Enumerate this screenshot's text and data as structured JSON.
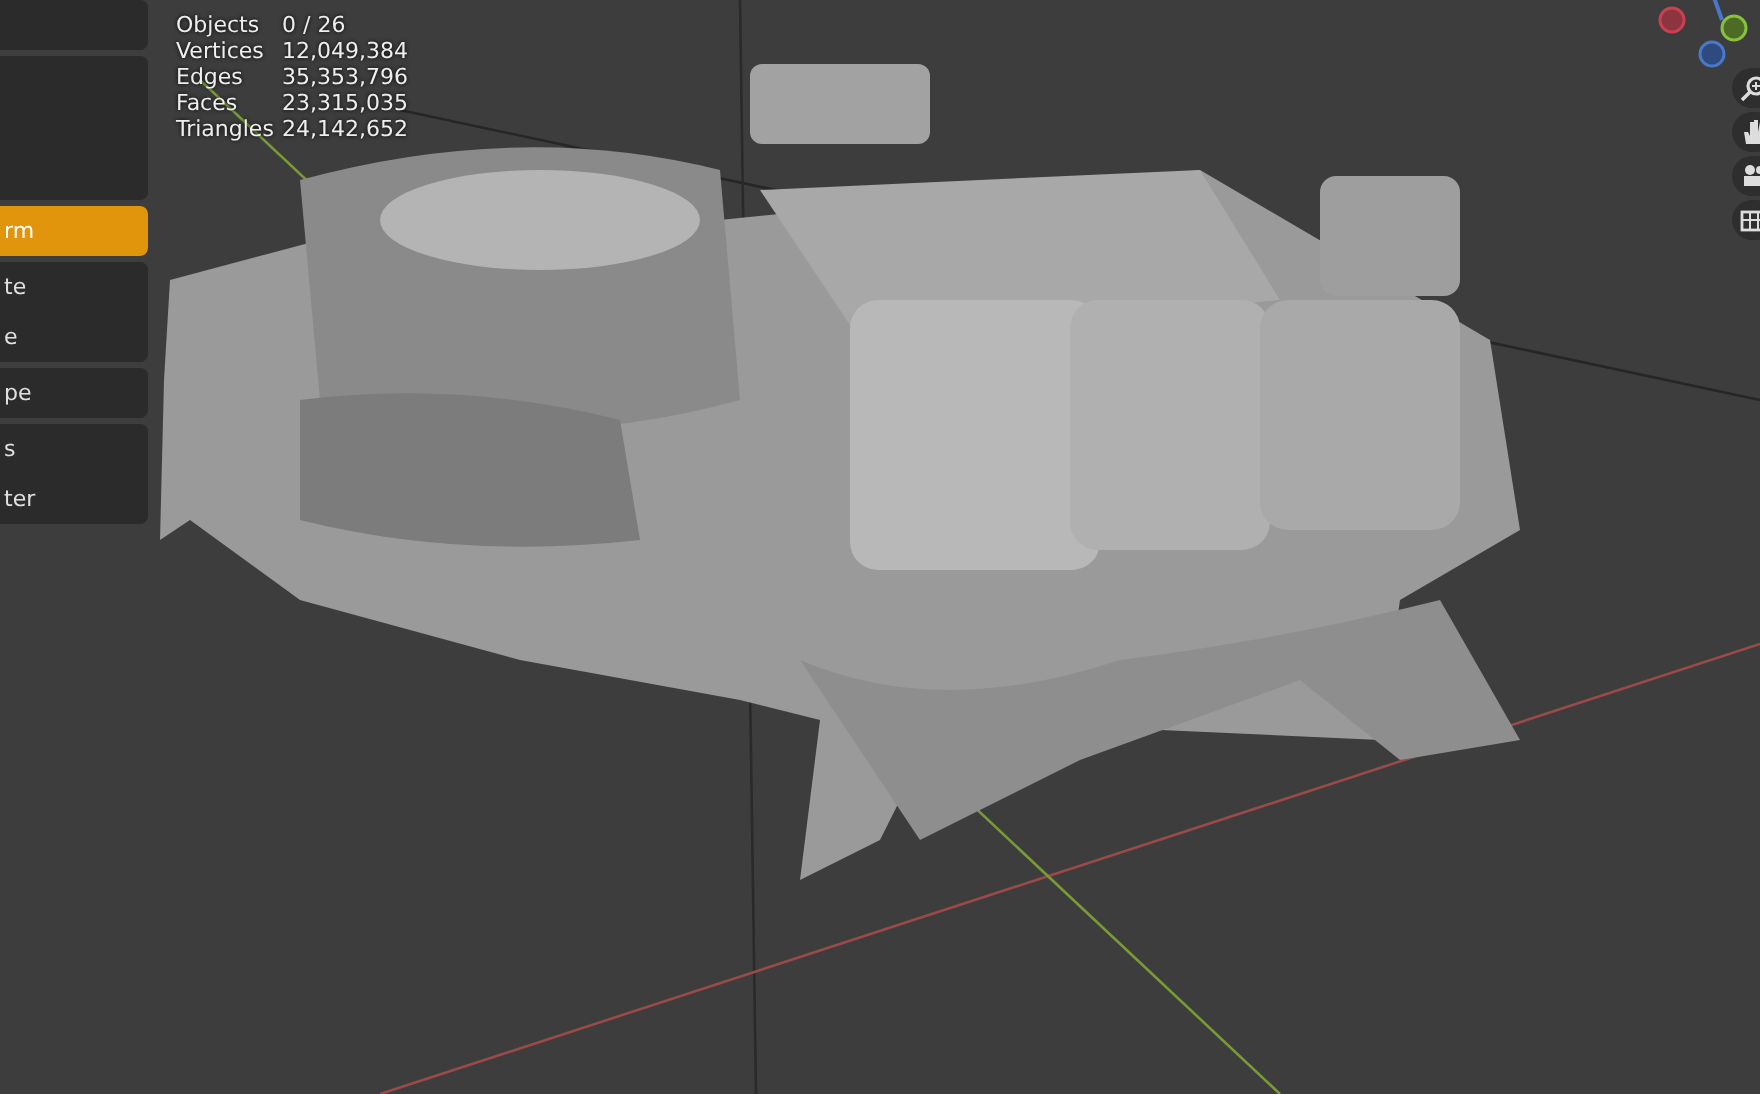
{
  "tool_panel": {
    "groups": [
      {
        "items": [
          {
            "label": "rm",
            "selected": true
          }
        ]
      },
      {
        "items": [
          {
            "label": "te",
            "selected": false
          },
          {
            "label": "e",
            "selected": false
          }
        ]
      },
      {
        "items": [
          {
            "label": "pe",
            "selected": false
          }
        ]
      },
      {
        "items": [
          {
            "label": "s",
            "selected": false
          },
          {
            "label": "ter",
            "selected": false
          }
        ]
      }
    ]
  },
  "statistics": [
    {
      "label": "Objects",
      "value": "0 / 26"
    },
    {
      "label": "Vertices",
      "value": "12,049,384"
    },
    {
      "label": "Edges",
      "value": "35,353,796"
    },
    {
      "label": "Faces",
      "value": "23,315,035"
    },
    {
      "label": "Triangles",
      "value": "24,142,652"
    }
  ]
}
